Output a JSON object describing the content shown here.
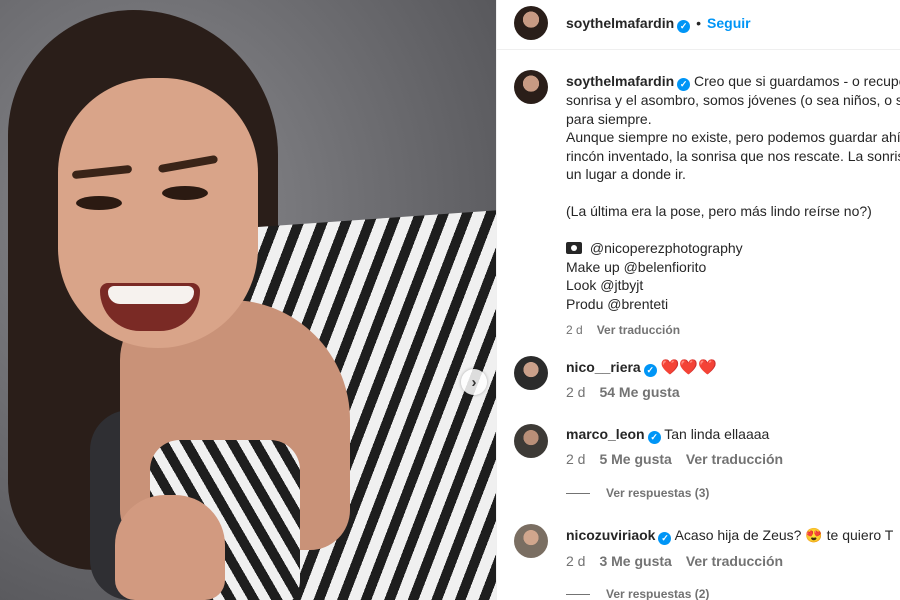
{
  "post": {
    "username": "soythelmafardin",
    "follow_label": "Seguir",
    "caption_lines": [
      "Creo que si guardamos - o recupe",
      "sonrisa y el asombro, somos jóvenes (o sea niños, o se",
      "para siempre.",
      "Aunque siempre no existe, pero podemos guardar ahí",
      "rincón inventado, la sonrisa que nos rescate. La sonris",
      "un lugar a donde ir.",
      "",
      "(La última era la pose, pero más lindo reírse no?)",
      "",
      "@nicoperezphotography",
      "Make up @belenfiorito",
      "Look @jtbyjt",
      "Produ @brenteti"
    ],
    "caption_time": "2 d",
    "translate_label": "Ver traducción"
  },
  "comments": [
    {
      "username": "nico__riera",
      "text": "❤️❤️❤️",
      "time": "2 d",
      "likes": "54 Me gusta",
      "translate": ""
    },
    {
      "username": "marco_leon",
      "text": "Tan linda ellaaaa",
      "time": "2 d",
      "likes": "5 Me gusta",
      "translate": "Ver traducción",
      "replies": "Ver respuestas (3)"
    },
    {
      "username": "nicozuviriaok",
      "text_before": "Acaso hija de Zeus?",
      "emoji": "😍",
      "text_after": "te quiero T",
      "time": "2 d",
      "likes": "3 Me gusta",
      "translate": "Ver traducción",
      "replies": "Ver respuestas (2)"
    }
  ],
  "icons": {
    "verified": "verified-badge-icon",
    "next": "chevron-right-icon",
    "camera": "camera-icon"
  },
  "colors": {
    "accent": "#0095f6",
    "heart": "#e0103a",
    "muted": "#737373"
  }
}
